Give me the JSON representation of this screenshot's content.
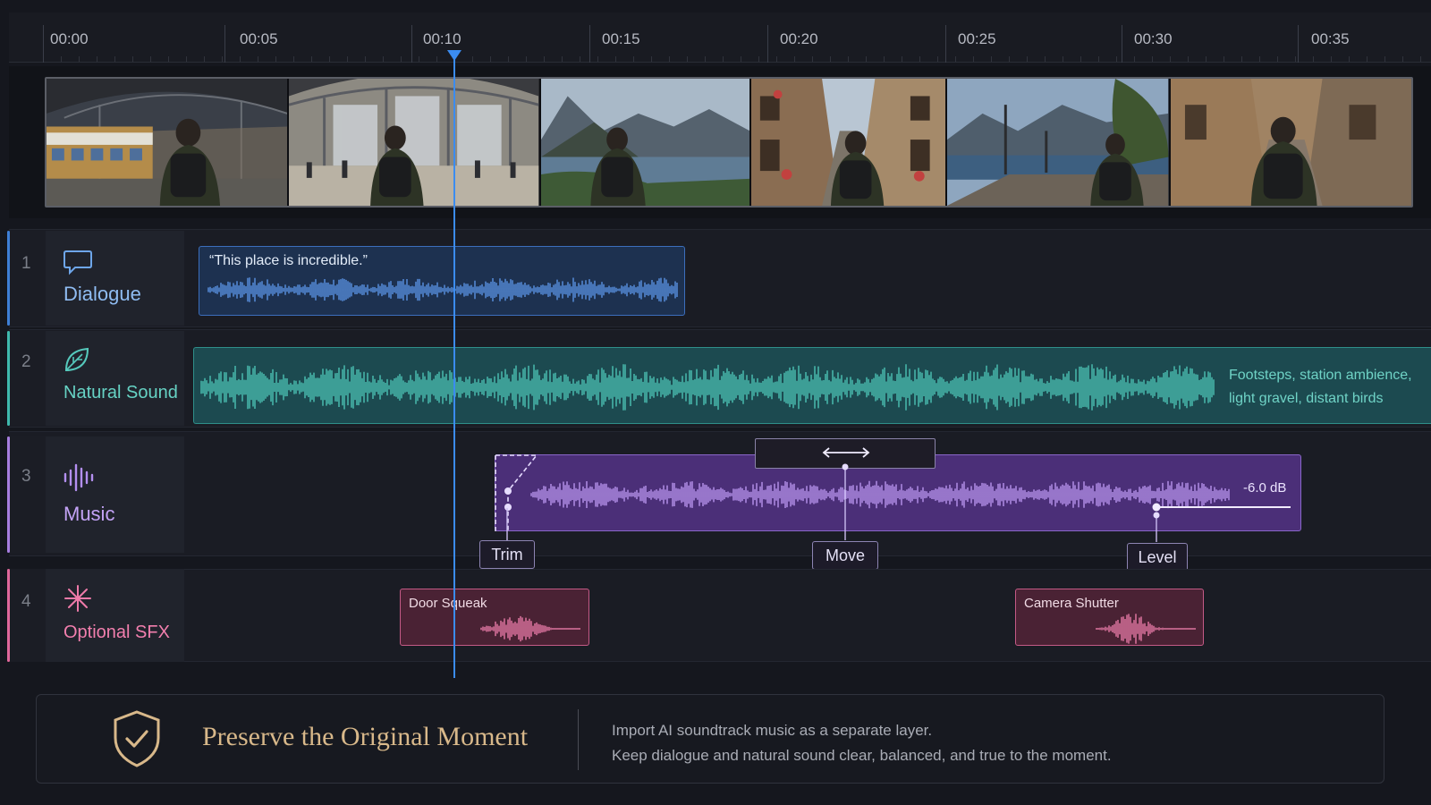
{
  "timeline": {
    "ruler_labels": [
      "00:00",
      "00:05",
      "00:10",
      "00:15",
      "00:20",
      "00:25",
      "00:30",
      "00:35"
    ],
    "playhead_time": "00:10",
    "playhead_color": "#3b8cf0"
  },
  "video_track": {
    "frames": [
      "train-station-platform",
      "station-hall",
      "mountain-lake",
      "old-town-street",
      "lakeside-promenade",
      "stone-alley"
    ]
  },
  "tracks": [
    {
      "number": "1",
      "title": "Dialogue",
      "icon": "speech-bubble-icon",
      "color": "#3e7fd6",
      "clips": [
        {
          "caption": "“This place is incredible.”"
        }
      ]
    },
    {
      "number": "2",
      "title": "Natural Sound",
      "icon": "leaf-icon",
      "color": "#3fb9ad",
      "clips": [
        {
          "description_line1": "Footsteps, station ambience,",
          "description_line2": "light gravel, distant birds"
        }
      ]
    },
    {
      "number": "3",
      "title": "Music",
      "icon": "waveform-icon",
      "color": "#a77ee0",
      "clips": [
        {
          "level": "-6.0 dB"
        }
      ],
      "handles": {
        "trim": "Trim",
        "move": "Move",
        "level": "Level"
      }
    },
    {
      "number": "4",
      "title": "Optional SFX",
      "icon": "sparkle-icon",
      "color": "#e0679a",
      "clips": [
        {
          "label": "Door Squeak"
        },
        {
          "label": "Camera Shutter"
        }
      ]
    }
  ],
  "footer": {
    "title": "Preserve the Original Moment",
    "line1": "Import AI soundtrack music as a separate layer.",
    "line2": "Keep dialogue and natural sound clear, balanced, and true to the moment.",
    "icon": "shield-check-icon",
    "accent": "#d8b88a"
  }
}
